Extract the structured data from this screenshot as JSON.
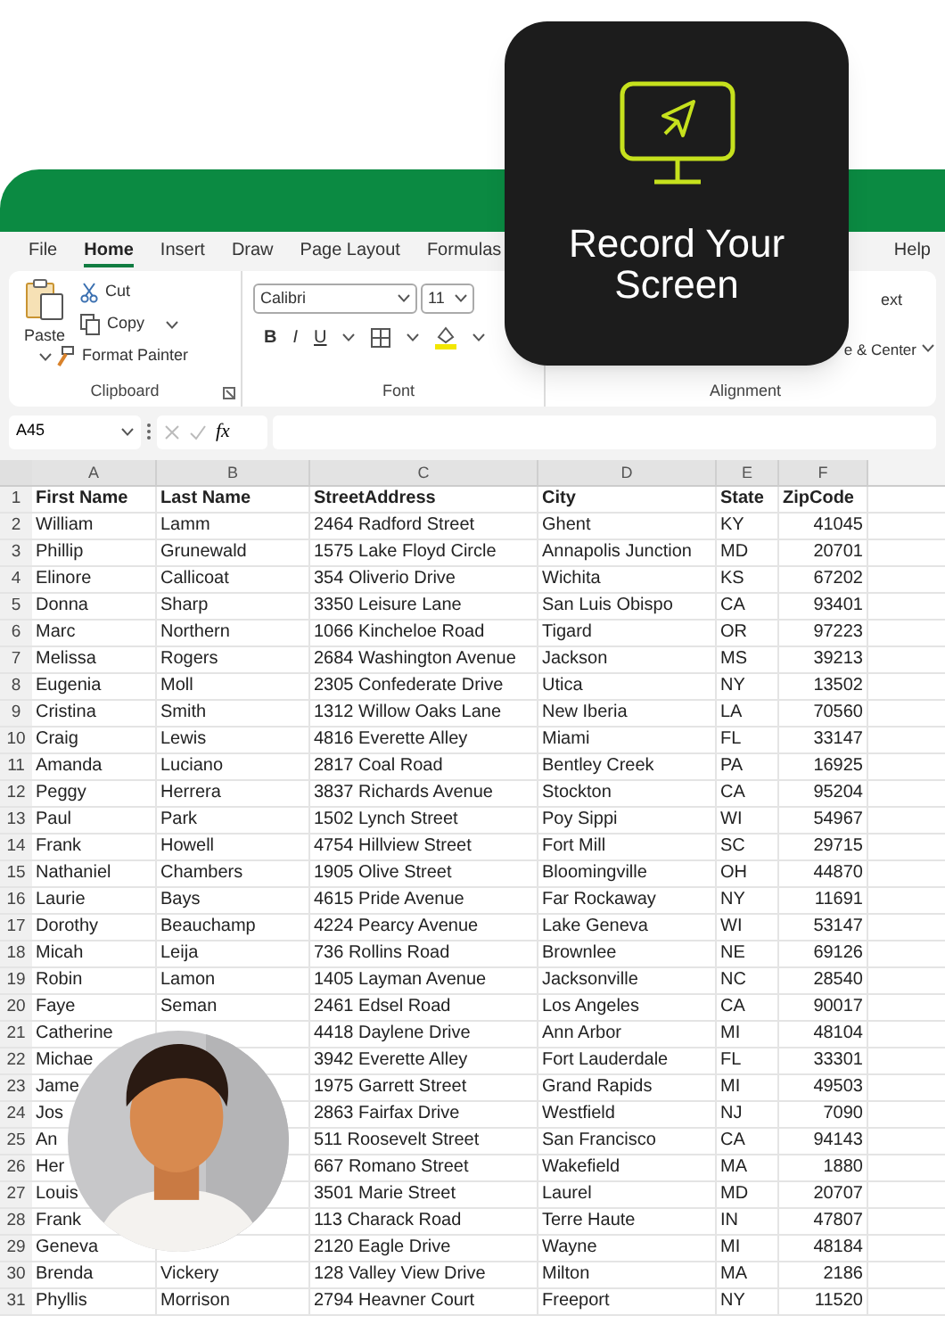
{
  "promo_card": {
    "title": "Record Your Screen"
  },
  "menu_tabs": [
    {
      "label": "File",
      "selected": false
    },
    {
      "label": "Home",
      "selected": true
    },
    {
      "label": "Insert",
      "selected": false
    },
    {
      "label": "Draw",
      "selected": false
    },
    {
      "label": "Page Layout",
      "selected": false
    },
    {
      "label": "Formulas",
      "selected": false
    },
    {
      "label": "Help",
      "selected": false
    }
  ],
  "ribbon": {
    "clipboard": {
      "paste": "Paste",
      "cut": "Cut",
      "copy": "Copy",
      "format_painter": "Format Painter",
      "label": "Clipboard"
    },
    "font": {
      "font_name": "Calibri",
      "font_size": "11",
      "bold": "B",
      "italic": "I",
      "underline": "U",
      "label": "Font"
    },
    "alignment": {
      "wrap_text": "ext",
      "merge": "e & Center",
      "label": "Alignment"
    }
  },
  "formula_bar": {
    "name_box": "A45",
    "fx": "fx"
  },
  "sheet": {
    "columns": [
      {
        "label": "A"
      },
      {
        "label": "B"
      },
      {
        "label": "C"
      },
      {
        "label": "D"
      },
      {
        "label": "E"
      },
      {
        "label": "F"
      }
    ],
    "rows": [
      {
        "number": "1",
        "kind": "header",
        "cells": [
          "First Name",
          "Last Name",
          "StreetAddress",
          "City",
          "State",
          "ZipCode"
        ]
      },
      {
        "number": "2",
        "kind": "data",
        "cells": [
          "William",
          "Lamm",
          "2464 Radford Street",
          "Ghent",
          "KY",
          "41045"
        ]
      },
      {
        "number": "3",
        "kind": "data",
        "cells": [
          "Phillip",
          "Grunewald",
          "1575 Lake Floyd Circle",
          "Annapolis Junction",
          "MD",
          "20701"
        ]
      },
      {
        "number": "4",
        "kind": "data",
        "cells": [
          "Elinore",
          "Callicoat",
          "354 Oliverio Drive",
          "Wichita",
          "KS",
          "67202"
        ]
      },
      {
        "number": "5",
        "kind": "data",
        "cells": [
          "Donna",
          "Sharp",
          "3350 Leisure Lane",
          "San Luis Obispo",
          "CA",
          "93401"
        ]
      },
      {
        "number": "6",
        "kind": "data",
        "cells": [
          "Marc",
          "Northern",
          "1066 Kincheloe Road",
          "Tigard",
          "OR",
          "97223"
        ]
      },
      {
        "number": "7",
        "kind": "data",
        "cells": [
          "Melissa",
          "Rogers",
          "2684 Washington Avenue",
          "Jackson",
          "MS",
          "39213"
        ]
      },
      {
        "number": "8",
        "kind": "data",
        "cells": [
          "Eugenia",
          "Moll",
          "2305 Confederate Drive",
          "Utica",
          "NY",
          "13502"
        ]
      },
      {
        "number": "9",
        "kind": "data",
        "cells": [
          "Cristina",
          "Smith",
          "1312 Willow Oaks Lane",
          "New Iberia",
          "LA",
          "70560"
        ]
      },
      {
        "number": "10",
        "kind": "data",
        "cells": [
          "Craig",
          "Lewis",
          "4816 Everette Alley",
          "Miami",
          "FL",
          "33147"
        ]
      },
      {
        "number": "11",
        "kind": "data",
        "cells": [
          "Amanda",
          "Luciano",
          "2817 Coal Road",
          "Bentley Creek",
          "PA",
          "16925"
        ]
      },
      {
        "number": "12",
        "kind": "data",
        "cells": [
          "Peggy",
          "Herrera",
          "3837 Richards Avenue",
          "Stockton",
          "CA",
          "95204"
        ]
      },
      {
        "number": "13",
        "kind": "data",
        "cells": [
          "Paul",
          "Park",
          "1502 Lynch Street",
          "Poy Sippi",
          "WI",
          "54967"
        ]
      },
      {
        "number": "14",
        "kind": "data",
        "cells": [
          "Frank",
          "Howell",
          "4754 Hillview Street",
          "Fort Mill",
          "SC",
          "29715"
        ]
      },
      {
        "number": "15",
        "kind": "data",
        "cells": [
          "Nathaniel",
          "Chambers",
          "1905 Olive Street",
          "Bloomingville",
          "OH",
          "44870"
        ]
      },
      {
        "number": "16",
        "kind": "data",
        "cells": [
          "Laurie",
          "Bays",
          "4615 Pride Avenue",
          "Far Rockaway",
          "NY",
          "11691"
        ]
      },
      {
        "number": "17",
        "kind": "data",
        "cells": [
          "Dorothy",
          "Beauchamp",
          "4224 Pearcy Avenue",
          "Lake Geneva",
          "WI",
          "53147"
        ]
      },
      {
        "number": "18",
        "kind": "data",
        "cells": [
          "Micah",
          "Leija",
          "736 Rollins Road",
          "Brownlee",
          "NE",
          "69126"
        ]
      },
      {
        "number": "19",
        "kind": "data",
        "cells": [
          "Robin",
          "Lamon",
          "1405 Layman Avenue",
          "Jacksonville",
          "NC",
          "28540"
        ]
      },
      {
        "number": "20",
        "kind": "data",
        "cells": [
          "Faye",
          "Seman",
          "2461 Edsel Road",
          "Los Angeles",
          "CA",
          "90017"
        ]
      },
      {
        "number": "21",
        "kind": "data",
        "cells": [
          "Catherine",
          null,
          "4418 Daylene Drive",
          "Ann Arbor",
          "MI",
          "48104"
        ]
      },
      {
        "number": "22",
        "kind": "data",
        "cells": [
          "Michae",
          null,
          "3942 Everette Alley",
          "Fort Lauderdale",
          "FL",
          "33301"
        ]
      },
      {
        "number": "23",
        "kind": "data",
        "cells": [
          "Jame",
          null,
          "1975 Garrett Street",
          "Grand Rapids",
          "MI",
          "49503"
        ]
      },
      {
        "number": "24",
        "kind": "data",
        "cells": [
          "Jos",
          null,
          "2863 Fairfax Drive",
          "Westfield",
          "NJ",
          "7090"
        ]
      },
      {
        "number": "25",
        "kind": "data",
        "cells": [
          "An",
          null,
          "511 Roosevelt Street",
          "San Francisco",
          "CA",
          "94143"
        ]
      },
      {
        "number": "26",
        "kind": "data",
        "cells": [
          "Her",
          null,
          "667 Romano Street",
          "Wakefield",
          "MA",
          "1880"
        ]
      },
      {
        "number": "27",
        "kind": "data",
        "cells": [
          "Louis",
          null,
          "3501 Marie Street",
          "Laurel",
          "MD",
          "20707"
        ]
      },
      {
        "number": "28",
        "kind": "data",
        "cells": [
          "Frank",
          null,
          "113 Charack Road",
          "Terre Haute",
          "IN",
          "47807"
        ]
      },
      {
        "number": "29",
        "kind": "data",
        "cells": [
          "Geneva",
          null,
          "2120 Eagle Drive",
          "Wayne",
          "MI",
          "48184"
        ]
      },
      {
        "number": "30",
        "kind": "data",
        "cells": [
          "Brenda",
          "Vickery",
          "128 Valley View Drive",
          "Milton",
          "MA",
          "2186"
        ]
      },
      {
        "number": "31",
        "kind": "data",
        "cells": [
          "Phyllis",
          "Morrison",
          "2794 Heavner Court",
          "Freeport",
          "NY",
          "11520"
        ]
      }
    ]
  }
}
